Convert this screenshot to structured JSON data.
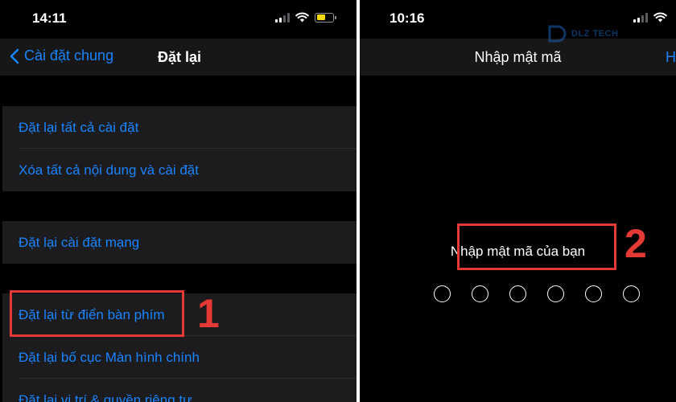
{
  "left": {
    "status": {
      "time": "14:11"
    },
    "nav": {
      "back_label": "Cài đặt chung",
      "title": "Đặt lại"
    },
    "groups": [
      {
        "items": [
          "Đặt lại tất cả cài đặt",
          "Xóa tất cả nội dung và cài đặt"
        ]
      },
      {
        "items": [
          "Đặt lại cài đặt mạng"
        ]
      },
      {
        "items": [
          "Đặt lại từ điển bàn phím",
          "Đặt lại bố cục Màn hình chính",
          "Đặt lại vị trí & quyền riêng tư"
        ]
      }
    ],
    "step_number": "1"
  },
  "right": {
    "status": {
      "time": "10:16"
    },
    "nav": {
      "title": "Nhập mật mã",
      "edge_label": "H"
    },
    "prompt": "Nhập mật mã của bạn",
    "passcode_length": 6,
    "step_number": "2",
    "watermark": "DLZ TECH"
  },
  "colors": {
    "accent": "#1a84ff",
    "annotation_red": "#e53935",
    "battery": "#f5d90a",
    "cell_bg": "#1c1c1e",
    "nav_bg": "#171717"
  },
  "icons": {
    "back": "chevron-left-icon",
    "signal": "cellular-signal-icon",
    "wifi": "wifi-icon",
    "battery": "battery-icon",
    "passcode_dot": "passcode-dot-icon"
  }
}
